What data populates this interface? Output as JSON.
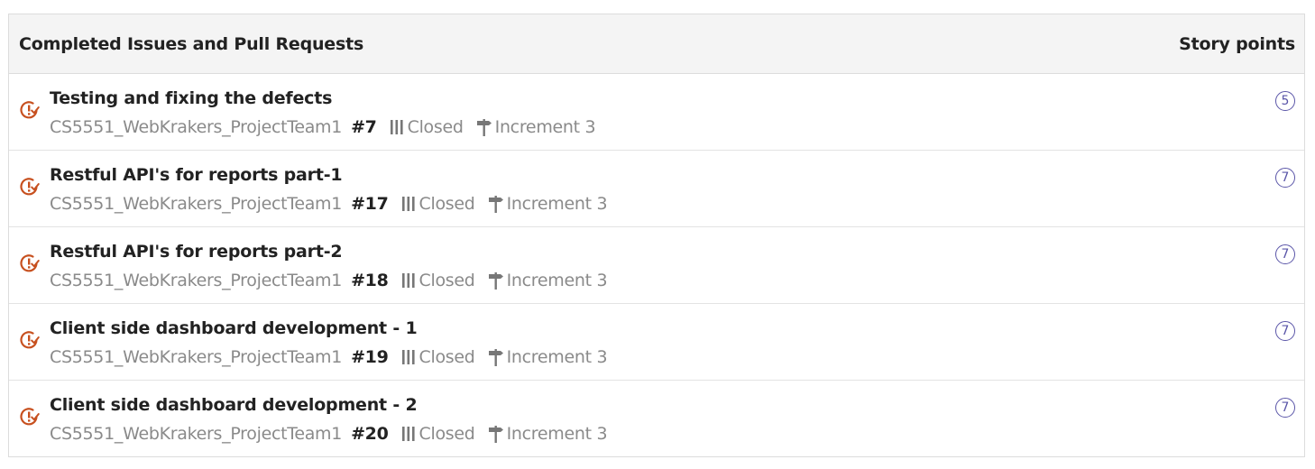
{
  "header": {
    "title": "Completed Issues and Pull Requests",
    "points_label": "Story points"
  },
  "colors": {
    "issue_icon": "#c7501f",
    "points_badge": "#5a55a8",
    "muted_text": "#8a8a8a"
  },
  "issues": [
    {
      "title": "Testing and fixing the defects",
      "repo": "CS5551_WebKrakers_ProjectTeam1",
      "number": "#7",
      "status": "Closed",
      "milestone": "Increment 3",
      "points": "5"
    },
    {
      "title": "Restful API's for reports part-1",
      "repo": "CS5551_WebKrakers_ProjectTeam1",
      "number": "#17",
      "status": "Closed",
      "milestone": "Increment 3",
      "points": "7"
    },
    {
      "title": "Restful API's for reports part-2",
      "repo": "CS5551_WebKrakers_ProjectTeam1",
      "number": "#18",
      "status": "Closed",
      "milestone": "Increment 3",
      "points": "7"
    },
    {
      "title": "Client side dashboard development - 1",
      "repo": "CS5551_WebKrakers_ProjectTeam1",
      "number": "#19",
      "status": "Closed",
      "milestone": "Increment 3",
      "points": "7"
    },
    {
      "title": "Client side dashboard development - 2",
      "repo": "CS5551_WebKrakers_ProjectTeam1",
      "number": "#20",
      "status": "Closed",
      "milestone": "Increment 3",
      "points": "7"
    }
  ]
}
